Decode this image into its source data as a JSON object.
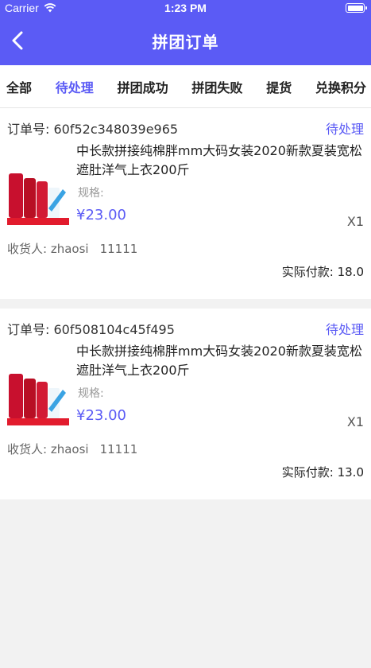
{
  "status_bar": {
    "carrier": "Carrier",
    "time": "1:23 PM"
  },
  "nav": {
    "title": "拼团订单"
  },
  "tabs": [
    "全部",
    "待处理",
    "拼团成功",
    "拼团失败",
    "提货",
    "兑换积分"
  ],
  "orders": [
    {
      "order_no": "订单号: 60f52c348039e965",
      "status": "待处理",
      "product_name": "中长款拼接纯棉胖mm大码女装2020新款夏装宽松遮肚洋气上衣200斤",
      "spec": "规格:",
      "price": "¥23.00",
      "qty": "X1",
      "receiver_label": "收货人: zhaosi",
      "receiver_phone": "11111",
      "paid": "实际付款: 18.0"
    },
    {
      "order_no": "订单号: 60f508104c45f495",
      "status": "待处理",
      "product_name": "中长款拼接纯棉胖mm大码女装2020新款夏装宽松遮肚洋气上衣200斤",
      "spec": "规格:",
      "price": "¥23.00",
      "qty": "X1",
      "receiver_label": "收货人: zhaosi",
      "receiver_phone": "11111",
      "paid": "实际付款: 13.0"
    }
  ],
  "colors": {
    "accent": "#5b5bf5",
    "header_bg": "#5b5bf5",
    "page_bg": "#f2f2f2"
  }
}
